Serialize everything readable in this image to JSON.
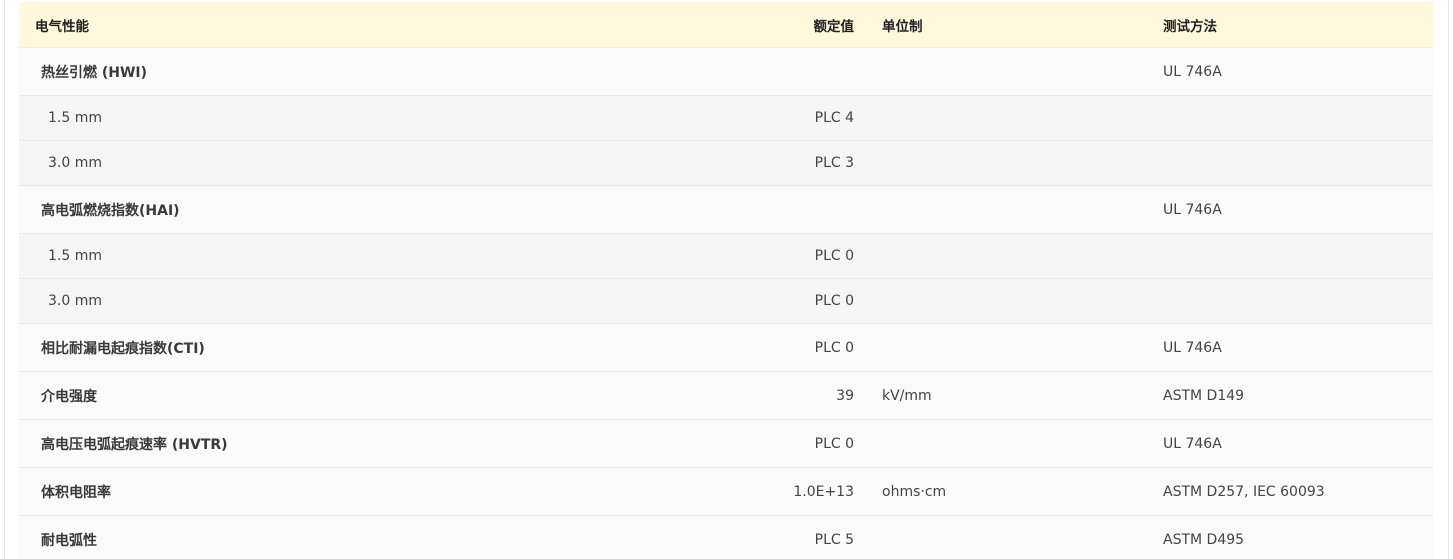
{
  "header": {
    "property": "电气性能",
    "value": "额定值",
    "unit": "单位制",
    "method": "测试方法"
  },
  "rows": [
    {
      "type": "main",
      "property": "热丝引燃 (HWI)",
      "value": "",
      "unit": "",
      "method": "UL 746A"
    },
    {
      "type": "sub",
      "property": "1.5 mm",
      "value": "PLC 4",
      "unit": "",
      "method": ""
    },
    {
      "type": "sub",
      "property": "3.0 mm",
      "value": "PLC 3",
      "unit": "",
      "method": ""
    },
    {
      "type": "main",
      "property": "高电弧燃烧指数(HAI)",
      "value": "",
      "unit": "",
      "method": "UL 746A"
    },
    {
      "type": "sub",
      "property": "1.5 mm",
      "value": "PLC 0",
      "unit": "",
      "method": ""
    },
    {
      "type": "sub",
      "property": "3.0 mm",
      "value": "PLC 0",
      "unit": "",
      "method": ""
    },
    {
      "type": "main",
      "property": "相比耐漏电起痕指数(CTI)",
      "value": "PLC 0",
      "unit": "",
      "method": "UL 746A"
    },
    {
      "type": "main",
      "property": "介电强度",
      "value": "39",
      "unit": "kV/mm",
      "method": "ASTM D149"
    },
    {
      "type": "main",
      "property": "高电压电弧起痕速率 (HVTR)",
      "value": "PLC 0",
      "unit": "",
      "method": "UL 746A"
    },
    {
      "type": "main",
      "property": "体积电阻率",
      "value": "1.0E+13",
      "unit": "ohms·cm",
      "method": "ASTM D257, IEC 60093"
    },
    {
      "type": "main",
      "property": "耐电弧性",
      "value": "PLC 5",
      "unit": "",
      "method": "ASTM D495"
    }
  ],
  "colors": {
    "header_bg": "#fff8dc",
    "main_row_bg": "#fafafa",
    "sub_row_bg": "#f5f5f5"
  }
}
